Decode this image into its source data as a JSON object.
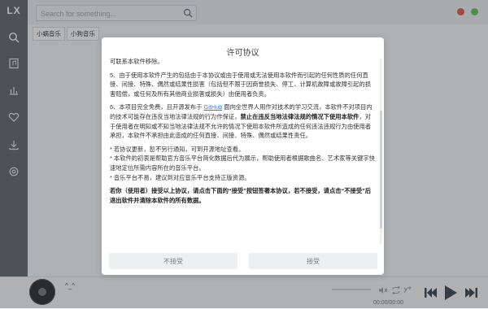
{
  "app": {
    "logo": "LX"
  },
  "search": {
    "placeholder": "Search for something..."
  },
  "tabs": [
    "小蜗音乐",
    "小狗音乐"
  ],
  "modal": {
    "title": "许可协议",
    "partial_top": "可联系本软件移除。",
    "item5": "5、由于使用本软件产生的包括由于本协议或由于使用或无法使用本软件而引起的任何性质的任何直接、间接、特殊、偶然或结果性损害（包括但不限于因商誉损失、停工、计算机故障或故障引起的损害赔偿，或任何及所有其他商业损害或损失）由使用者负责。",
    "item6_a": "6、本项目完全免费，且开源发布于 ",
    "item6_link": "GitHub",
    "item6_b": " 面向全世界人用作对技术的学习交流，本软件不对项目内的技术可能存在违反当地法律法规的行为作保证，",
    "item6_bold": "禁止在违反当地法律法规的情况下使用本软件",
    "item6_c": "，对于使用者在明知或不知当地法律法规不允许的情况下使用本软件所造成的任何违法违规行为由使用者承担，本软件不承担由此造成的任何直接、间接、特殊、偶然或结果性责任。",
    "note1": "* 若协议更新，恕不另行通知，可到开源地址查看。",
    "note2": "* 本软件的初衷是帮助官方音乐平台简化数据后代为展示，帮助使用者根据歌曲名、艺术家等关键字快速地定位所需内容所在的音乐平台。",
    "note3": "* 音乐平台不易，建议到对应音乐平台支持正版资源。",
    "final": "若你（使用者）接受以上协议，请点击下面的“接受”按钮签署本协议，若不接受，请点击“不接受”后退出软件并清除本软件的所有数据。",
    "decline_label": "不接受",
    "accept_label": "接受"
  },
  "player": {
    "song": "^_^",
    "time": "00:00/00:00"
  },
  "colors": {
    "sidebar": "#5f676e",
    "accent": "#4fb4a8",
    "dot_red": "#e45b4f",
    "dot_green": "#66c05b"
  },
  "icons": [
    "search-icon",
    "music-list-icon",
    "chart-icon",
    "heart-icon",
    "download-icon",
    "settings-icon",
    "volume-mute-icon",
    "loop-icon",
    "repeat-icon",
    "prev-icon",
    "play-icon",
    "next-icon"
  ]
}
